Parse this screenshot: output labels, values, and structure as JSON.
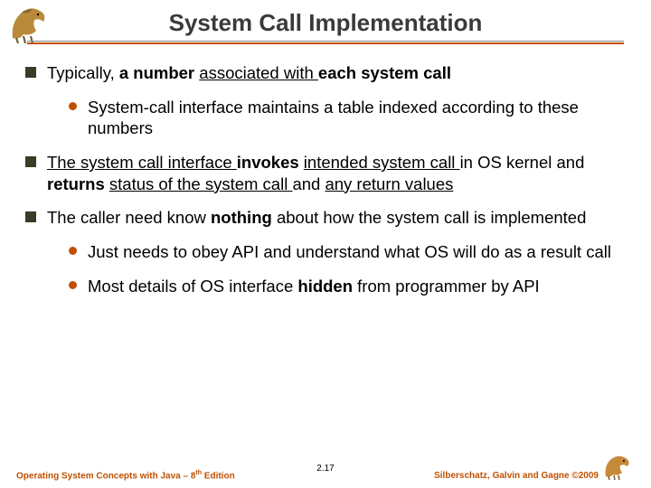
{
  "title": "System Call Implementation",
  "bullets": {
    "b1_pre": "Typically, ",
    "b1_bold1": "a number ",
    "b1_u1": "associated with ",
    "b1_bold2": "each system call",
    "b1_sub1": "System-call interface maintains a table indexed according to these numbers",
    "b2_u1": "The system call interface ",
    "b2_b1": "invokes ",
    "b2_u2": "intended system call ",
    "b2_t1": "in OS kernel and ",
    "b2_b2": "returns ",
    "b2_u3": "status of the system call ",
    "b2_t2": "and ",
    "b2_u4": "any return values",
    "b3_t1": "The caller need know ",
    "b3_b1": "nothing",
    "b3_t2": " about how the system call is implemented",
    "b3_sub1": "Just needs to obey API and understand what OS will do as a result call",
    "b3_sub2_t1": "Most details of  OS interface ",
    "b3_sub2_b1": "hidden ",
    "b3_sub2_t2": "from programmer by API"
  },
  "footer": {
    "left_pre": "Operating System Concepts  with Java – 8",
    "left_sup": "th",
    "left_post": " Edition",
    "center": "2.17",
    "right": "Silberschatz, Galvin and Gagne ©2009"
  }
}
